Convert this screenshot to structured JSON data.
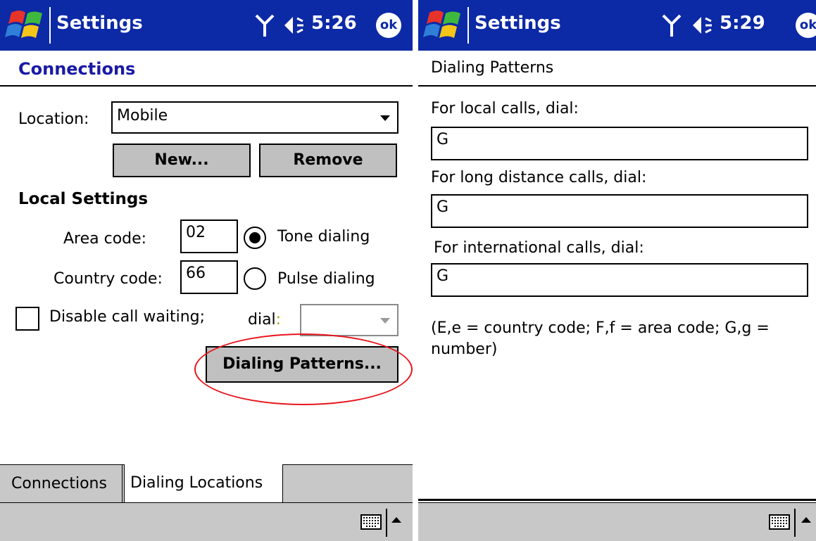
{
  "left": {
    "titlebar": {
      "title": "Settings",
      "time": "5:26",
      "ok": "ok"
    },
    "heading": "Connections",
    "location": {
      "label": "Location:",
      "value": "Mobile"
    },
    "buttons": {
      "new": "New...",
      "remove": "Remove",
      "dialing_patterns": "Dialing Patterns..."
    },
    "local_settings": {
      "title": "Local Settings",
      "area_code_label": "Area code:",
      "area_code_value": "02",
      "country_code_label": "Country code:",
      "country_code_value": "66",
      "tone_label": "Tone dialing",
      "pulse_label": "Pulse dialing",
      "call_waiting_label": "Disable call waiting;",
      "dial_label": "dial",
      "dial_colon": ":"
    },
    "tabs": [
      {
        "label": "Connections"
      },
      {
        "label": "Dialing Locations"
      }
    ],
    "colors": {
      "titlebar": "#0c29a6",
      "highlight_ellipse": "#e8141c"
    }
  },
  "right": {
    "titlebar": {
      "title": "Settings",
      "time": "5:29",
      "ok": "ok"
    },
    "heading": "Dialing Patterns",
    "fields": [
      {
        "label": "For local calls, dial:",
        "value": "G"
      },
      {
        "label": "For long distance calls, dial:",
        "value": "G"
      },
      {
        "label": "For international calls, dial:",
        "value": "G"
      }
    ],
    "legend": "(E,e = country code; F,f = area code; G,g = number)"
  }
}
